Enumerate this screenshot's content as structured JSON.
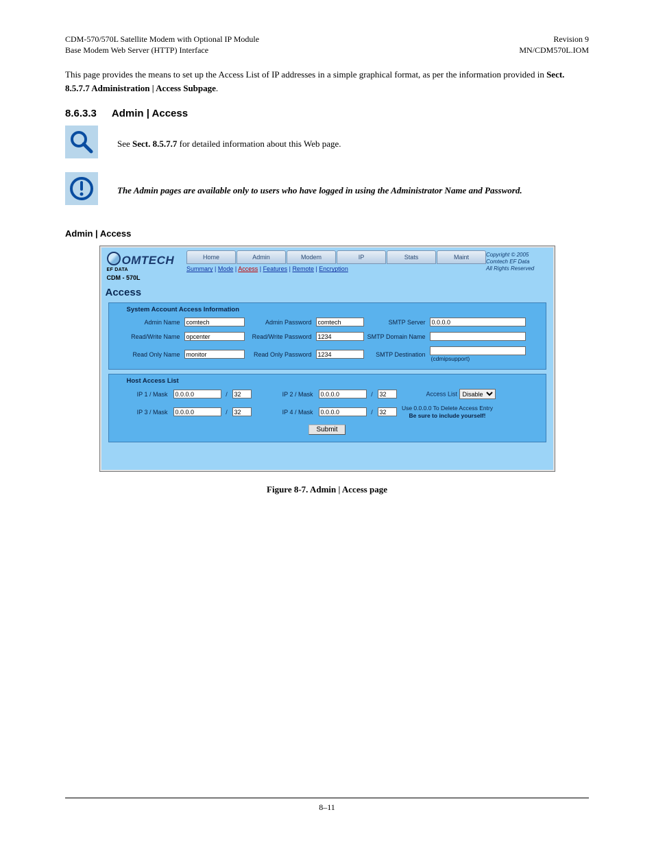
{
  "doc": {
    "header_left_1": "CDM-570/570L Satellite Modem with Optional IP Module",
    "header_left_2": "Base Modem Web Server (HTTP) Interface",
    "header_right_1": "Revision 9",
    "header_right_2": "MN/CDM570L.IOM",
    "intro": "This page provides the means to set up the Access List of IP addresses in a simple graphical format, as per the information provided in ",
    "intro_bold": "Sect. 8.5.7.7 Administration | Access Subpage",
    "intro_tail": ".",
    "sec_num": "8.6.3.3",
    "sec_title": "Admin | Access",
    "note1": "See ",
    "note1_bold": "Sect. 8.5.7.7",
    "note1_tail": " for detailed information about this Web page.",
    "note2": "The Admin pages are available only to users who have logged in using the Administrator Name and Password.",
    "page_title": "Access",
    "panel1_head": "System Account Access Information",
    "labels": {
      "admin_name": "Admin Name",
      "rw_name": "Read/Write Name",
      "ro_name": "Read Only Name",
      "admin_pw": "Admin Password",
      "rw_pw": "Read/Write Password",
      "ro_pw": "Read Only Password",
      "smtp_server": "SMTP Server",
      "smtp_domain": "SMTP Domain Name",
      "smtp_dest": "SMTP Destination",
      "hint": "(cdmipsupport)"
    },
    "values": {
      "admin_name": "comtech",
      "rw_name": "opcenter",
      "ro_name": "monitor",
      "admin_pw": "comtech",
      "rw_pw": "1234",
      "ro_pw": "1234",
      "smtp_server": "0.0.0.0",
      "smtp_domain": "",
      "smtp_dest": ""
    },
    "panel2_head": "Host Access List",
    "hal": {
      "ip1_lbl": "IP 1 / Mask",
      "ip2_lbl": "IP 2 / Mask",
      "ip3_lbl": "IP 3 / Mask",
      "ip4_lbl": "IP 4 / Mask",
      "ip": "0.0.0.0",
      "mask": "32",
      "al_label": "Access List",
      "al_value": "Disable",
      "msg1": "Use 0.0.0.0 To Delete Access Entry",
      "msg2": "Be sure to include yourself!"
    },
    "submit": "Submit",
    "tabs": [
      "Home",
      "Admin",
      "Modem",
      "IP",
      "Stats",
      "Maint"
    ],
    "subtabs": [
      "Summary",
      "Mode",
      "Access",
      "Features",
      "Remote",
      "Encryption"
    ],
    "copyright": [
      "Copyright © 2005",
      "Comtech EF Data",
      "All Rights Reserved"
    ],
    "brand": "OMTECH",
    "brand_sub": "EF DATA",
    "model": "CDM - 570L",
    "fig": "Figure 8-7. Admin | Access page",
    "footer": "8–11"
  }
}
